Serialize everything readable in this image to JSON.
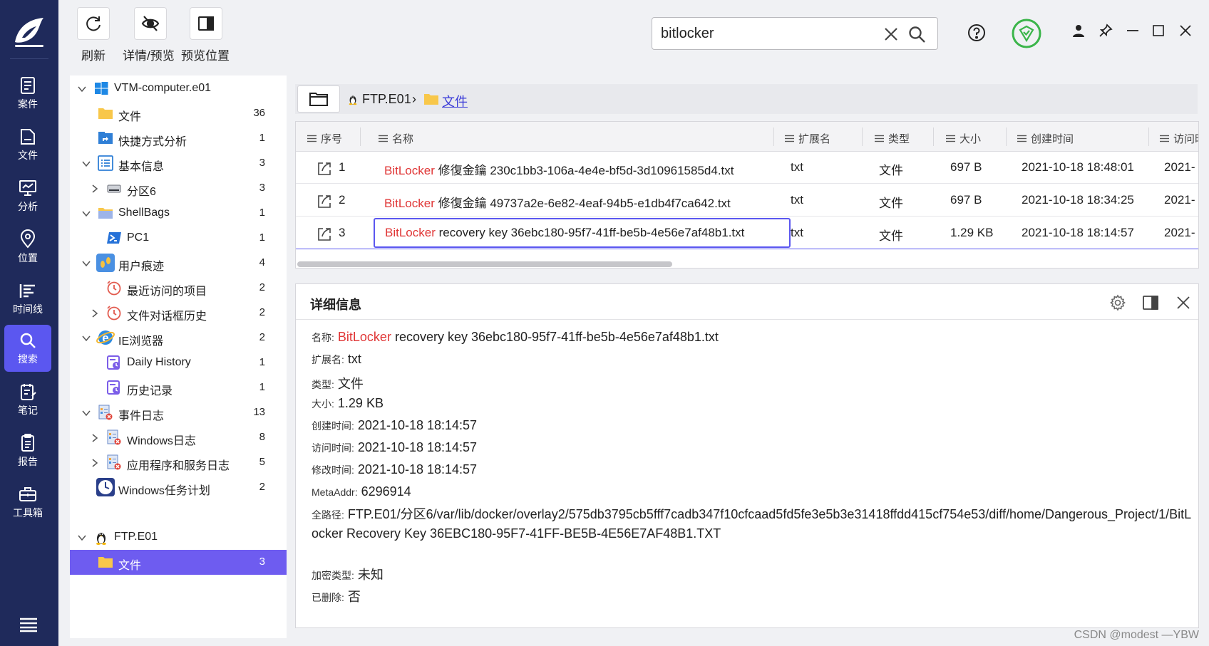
{
  "nav": {
    "items": [
      {
        "label": "案件",
        "icon": "case-icon"
      },
      {
        "label": "文件",
        "icon": "file-icon"
      },
      {
        "label": "分析",
        "icon": "analysis-icon"
      },
      {
        "label": "位置",
        "icon": "location-icon"
      },
      {
        "label": "时间线",
        "icon": "timeline-icon"
      },
      {
        "label": "搜索",
        "icon": "search-icon",
        "active": true
      },
      {
        "label": "笔记",
        "icon": "notes-icon"
      },
      {
        "label": "报告",
        "icon": "report-icon"
      },
      {
        "label": "工具箱",
        "icon": "toolbox-icon"
      }
    ],
    "active_color": "#5b57f0",
    "bg_color": "#1f2a5b"
  },
  "toolbar": {
    "refresh_label": "刷新",
    "detail_preview_label": "详情/预览",
    "preview_position_label": "预览位置"
  },
  "search": {
    "value": "bitlocker"
  },
  "tree": {
    "nodes": [
      {
        "label": "VTM-computer.e01",
        "count": "",
        "icon": "windows-icon"
      },
      {
        "label": "文件",
        "count": "36",
        "icon": "folder-icon"
      },
      {
        "label": "快捷方式分析",
        "count": "1",
        "icon": "shortcut-icon"
      },
      {
        "label": "基本信息",
        "count": "3",
        "icon": "list-icon"
      },
      {
        "label": "分区6",
        "count": "3",
        "icon": "drive-icon"
      },
      {
        "label": "ShellBags",
        "count": "1",
        "icon": "folder-icon"
      },
      {
        "label": "PC1",
        "count": "1",
        "icon": "powershell-icon"
      },
      {
        "label": "用户痕迹",
        "count": "4",
        "icon": "footprints-icon"
      },
      {
        "label": "最近访问的项目",
        "count": "2",
        "icon": "recent-clock-icon"
      },
      {
        "label": "文件对话框历史",
        "count": "2",
        "icon": "recent-clock-icon"
      },
      {
        "label": "IE浏览器",
        "count": "2",
        "icon": "ie-icon"
      },
      {
        "label": "Daily History",
        "count": "1",
        "icon": "history-icon"
      },
      {
        "label": "历史记录",
        "count": "1",
        "icon": "history-icon"
      },
      {
        "label": "事件日志",
        "count": "13",
        "icon": "event-log-icon"
      },
      {
        "label": "Windows日志",
        "count": "8",
        "icon": "event-log-icon"
      },
      {
        "label": "应用程序和服务日志",
        "count": "5",
        "icon": "event-log-icon"
      },
      {
        "label": "Windows任务计划",
        "count": "2",
        "icon": "task-clock-icon"
      },
      {
        "label": "FTP.E01",
        "count": "",
        "icon": "linux-icon"
      },
      {
        "label": "文件",
        "count": "3",
        "icon": "folder-icon",
        "selected": true
      }
    ]
  },
  "breadcrumb": {
    "root": "FTP.E01",
    "separator": "›",
    "current": "文件"
  },
  "grid": {
    "columns": [
      "序号",
      "名称",
      "扩展名",
      "类型",
      "大小",
      "创建时间",
      "访问时"
    ],
    "rows": [
      {
        "index": "1",
        "name_hl": "BitLocker",
        "name_rest": " 修復金鑰 230c1bb3-106a-4e4e-bf5d-3d10961585d4.txt",
        "ext": "txt",
        "type": "文件",
        "size": "697 B",
        "created": "2021-10-18 18:48:01",
        "accessed": "2021-"
      },
      {
        "index": "2",
        "name_hl": "BitLocker",
        "name_rest": " 修復金鑰 49737a2e-6e82-4eaf-94b5-e1db4f7ca642.txt",
        "ext": "txt",
        "type": "文件",
        "size": "697 B",
        "created": "2021-10-18 18:34:25",
        "accessed": "2021-"
      },
      {
        "index": "3",
        "name_hl": "BitLocker",
        "name_rest": " recovery key 36ebc180-95f7-41ff-be5b-4e56e7af48b1.txt",
        "ext": "txt",
        "type": "文件",
        "size": "1.29 KB",
        "created": "2021-10-18 18:14:57",
        "accessed": "2021-"
      }
    ],
    "highlight_color": "#e03636"
  },
  "detail": {
    "title": "详细信息",
    "name_key": "名称:",
    "name_hl": "BitLocker",
    "name_rest": " recovery key 36ebc180-95f7-41ff-be5b-4e56e7af48b1.txt",
    "ext_key": "扩展名:",
    "ext": "txt",
    "type_key": "类型:",
    "type": "文件",
    "size_key": "大小:",
    "size": "1.29 KB",
    "created_key": "创建时间:",
    "created": "2021-10-18 18:14:57",
    "accessed_key": "访问时间:",
    "accessed": "2021-10-18 18:14:57",
    "modified_key": "修改时间:",
    "modified": "2021-10-18 18:14:57",
    "meta_key": "MetaAddr:",
    "meta": "6296914",
    "path_key": "全路径:",
    "path": "FTP.E01/分区6/var/lib/docker/overlay2/575db3795cb5fff7cadb347f10cfcaad5fd5fe3e5b3e31418ffdd415cf754e53/diff/home/Dangerous_Project/1/BitLocker Recovery Key 36EBC180-95F7-41FF-BE5B-4E56E7AF48B1.TXT",
    "encrypt_key": "加密类型:",
    "encrypt": "未知",
    "deleted_key": "已删除:",
    "deleted": "否"
  },
  "watermark": "CSDN @modest —YBW"
}
